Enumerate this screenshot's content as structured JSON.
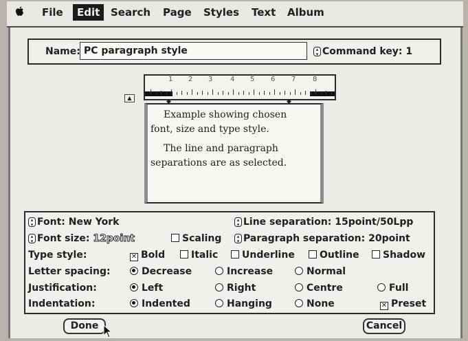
{
  "menubar": {
    "apple": "",
    "items": [
      {
        "label": "File"
      },
      {
        "label": "Edit",
        "active": true
      },
      {
        "label": "Search"
      },
      {
        "label": "Page"
      },
      {
        "label": "Styles"
      },
      {
        "label": "Text"
      },
      {
        "label": "Album"
      }
    ]
  },
  "style_dialog": {
    "name_label": "Name:",
    "name_value": "PC paragraph style",
    "command_key_label": "Command key: 1",
    "ruler_numbers": [
      "1",
      "2",
      "3",
      "4",
      "5",
      "6",
      "7",
      "8"
    ],
    "example_text": {
      "line1": "Example showing chosen",
      "line2": "font, size and type style.",
      "line3": "The line and paragraph",
      "line4": "separations are as selected."
    },
    "font_label": "Font: New York",
    "line_separation_label": "Line separation: 15point/50Lpp",
    "font_size_label": "Font size:",
    "font_size_value": "12point",
    "scaling_label": "Scaling",
    "paragraph_separation_label": "Paragraph separation: 20point",
    "type_style": {
      "label": "Type style:",
      "options": [
        {
          "label": "Bold",
          "checked": true
        },
        {
          "label": "Italic",
          "checked": false
        },
        {
          "label": "Underline",
          "checked": false
        },
        {
          "label": "Outline",
          "checked": false
        },
        {
          "label": "Shadow",
          "checked": false
        }
      ]
    },
    "letter_spacing": {
      "label": "Letter spacing:",
      "options": [
        {
          "label": "Decrease",
          "selected": true
        },
        {
          "label": "Increase",
          "selected": false
        },
        {
          "label": "Normal",
          "selected": false
        }
      ]
    },
    "justification": {
      "label": "Justification:",
      "options": [
        {
          "label": "Left",
          "selected": true
        },
        {
          "label": "Right",
          "selected": false
        },
        {
          "label": "Centre",
          "selected": false
        },
        {
          "label": "Full",
          "selected": false
        }
      ]
    },
    "indentation": {
      "label": "Indentation:",
      "options": [
        {
          "label": "Indented",
          "selected": true
        },
        {
          "label": "Hanging",
          "selected": false
        },
        {
          "label": "None",
          "selected": false
        }
      ],
      "preset_label": "Preset",
      "preset_checked": true
    },
    "done_label": "Done",
    "cancel_label": "Cancel"
  }
}
